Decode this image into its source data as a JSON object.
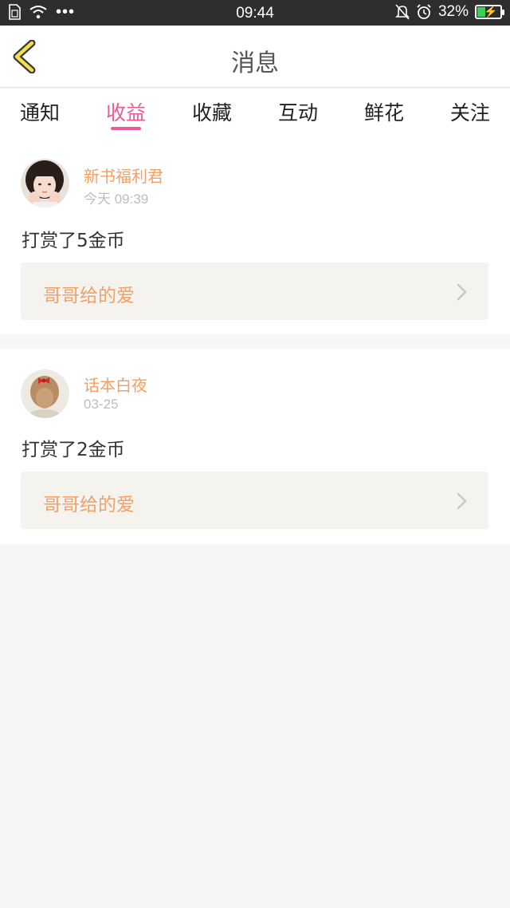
{
  "status_bar": {
    "time": "09:44",
    "dots": "•••",
    "battery_percent": "32%",
    "battery_level": 0.32,
    "icons": [
      "sim-icon",
      "wifi-icon",
      "mute-icon",
      "alarm-icon",
      "battery-charging-icon"
    ]
  },
  "header": {
    "title": "消息",
    "back_icon": "chevron-left-icon",
    "accent_color": "#f5e04a"
  },
  "tabs": [
    {
      "label": "通知",
      "active": false
    },
    {
      "label": "收益",
      "active": true
    },
    {
      "label": "收藏",
      "active": false
    },
    {
      "label": "互动",
      "active": false
    },
    {
      "label": "鲜花",
      "active": false
    },
    {
      "label": "关注",
      "active": false
    }
  ],
  "colors": {
    "active_tab": "#e95a98",
    "username": "#f0a068",
    "link_bg": "#f4f3ed"
  },
  "messages": [
    {
      "username": "新书福利君",
      "time": "今天 09:39",
      "action": "打赏了5金币",
      "link_label": "哥哥给的爱"
    },
    {
      "username": "话本白夜",
      "time": "03-25",
      "action": "打赏了2金币",
      "link_label": "哥哥给的爱"
    }
  ]
}
